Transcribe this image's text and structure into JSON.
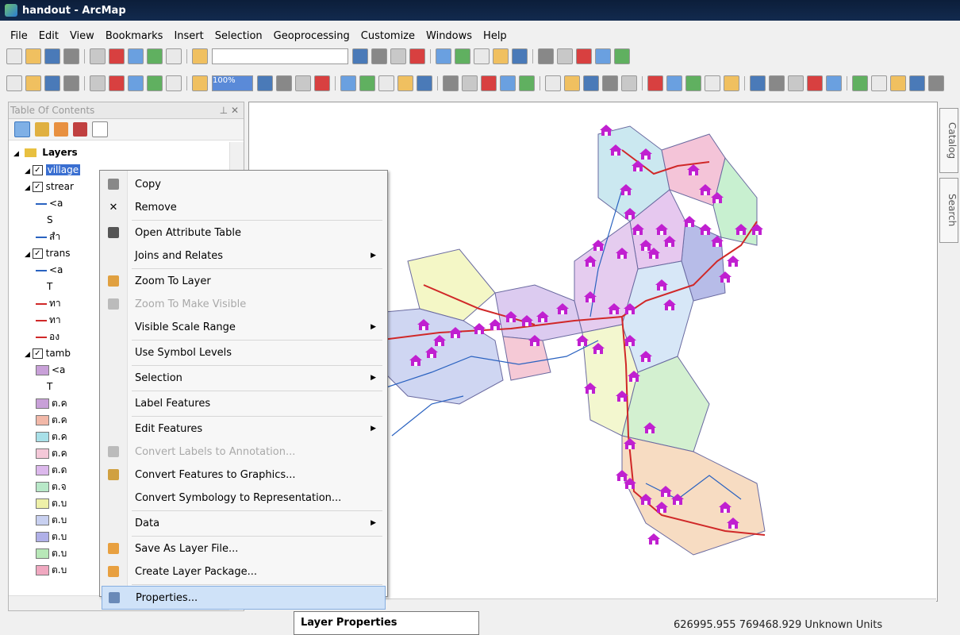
{
  "window": {
    "title": "handout - ArcMap"
  },
  "menu": [
    "File",
    "Edit",
    "View",
    "Bookmarks",
    "Insert",
    "Selection",
    "Geoprocessing",
    "Customize",
    "Windows",
    "Help"
  ],
  "toolbar": {
    "scale_value": "100%"
  },
  "toc": {
    "title": "Table Of Contents",
    "root_label": "Layers",
    "rows": [
      {
        "label": "village",
        "indent": 1,
        "check": true,
        "selected": true
      },
      {
        "label": "strear",
        "indent": 1,
        "check": true
      },
      {
        "label": "<a",
        "indent": 2
      },
      {
        "label": "S",
        "indent": 3
      },
      {
        "label": "สำ",
        "indent": 2
      },
      {
        "label": "trans",
        "indent": 1,
        "check": true
      },
      {
        "label": "<a",
        "indent": 2
      },
      {
        "label": "T",
        "indent": 3
      },
      {
        "label": "ทา",
        "indent": 2
      },
      {
        "label": "ทา",
        "indent": 2
      },
      {
        "label": "อง",
        "indent": 2
      },
      {
        "label": "tamb",
        "indent": 1,
        "check": true
      },
      {
        "label": "<a",
        "indent": 2
      },
      {
        "label": "T",
        "indent": 3
      },
      {
        "label": "ต.ค",
        "indent": 2
      },
      {
        "label": "ต.ค",
        "indent": 2
      },
      {
        "label": "ต.ค",
        "indent": 2
      },
      {
        "label": "ต.ค",
        "indent": 2
      },
      {
        "label": "ต.ด",
        "indent": 2
      },
      {
        "label": "ต.จ",
        "indent": 2
      },
      {
        "label": "ต.บ",
        "indent": 2
      },
      {
        "label": "ต.บ",
        "indent": 2
      },
      {
        "label": "ต.บ",
        "indent": 2
      },
      {
        "label": "ต.บ",
        "indent": 2
      },
      {
        "label": "ต.บ",
        "indent": 2
      }
    ],
    "swatch_colors": [
      "#c8a0d8",
      "#f2b8a8",
      "#a8e0e8",
      "#f4c8d8",
      "#dcb8ec",
      "#b8e8c8",
      "#eef0a8",
      "#c8d0f0",
      "#b0b0e8",
      "#b8e8b8",
      "#f0a8c0",
      "#d8f0c8"
    ]
  },
  "context_menu": {
    "items": [
      {
        "label": "Copy",
        "icon": "copy-icon"
      },
      {
        "label": "Remove",
        "icon": "remove-icon"
      },
      {
        "label": "Open Attribute Table",
        "icon": "table-icon",
        "sep_before": true
      },
      {
        "label": "Joins and Relates",
        "submenu": true
      },
      {
        "label": "Zoom To Layer",
        "icon": "zoom-layer-icon",
        "sep_before": true
      },
      {
        "label": "Zoom To Make Visible",
        "disabled": true,
        "icon": "zoom-visible-icon"
      },
      {
        "label": "Visible Scale Range",
        "submenu": true
      },
      {
        "label": "Use Symbol Levels",
        "sep_before": true
      },
      {
        "label": "Selection",
        "submenu": true,
        "sep_before": true
      },
      {
        "label": "Label Features",
        "sep_before": true
      },
      {
        "label": "Edit Features",
        "submenu": true,
        "sep_before": true
      },
      {
        "label": "Convert Labels to Annotation...",
        "disabled": true,
        "icon": "convert-labels-icon"
      },
      {
        "label": "Convert Features to Graphics...",
        "icon": "convert-features-icon"
      },
      {
        "label": "Convert Symbology to Representation..."
      },
      {
        "label": "Data",
        "submenu": true,
        "sep_before": true
      },
      {
        "label": "Save As Layer File...",
        "icon": "layer-file-icon",
        "sep_before": true
      },
      {
        "label": "Create Layer Package...",
        "icon": "layer-package-icon"
      },
      {
        "label": "Properties...",
        "icon": "properties-icon",
        "highlighted": true,
        "sep_before": true
      }
    ]
  },
  "right_tabs": [
    "Catalog",
    "Search"
  ],
  "tooltip": "Layer Properties",
  "status": {
    "coordinates": "626995.955  769468.929 Unknown Units"
  }
}
